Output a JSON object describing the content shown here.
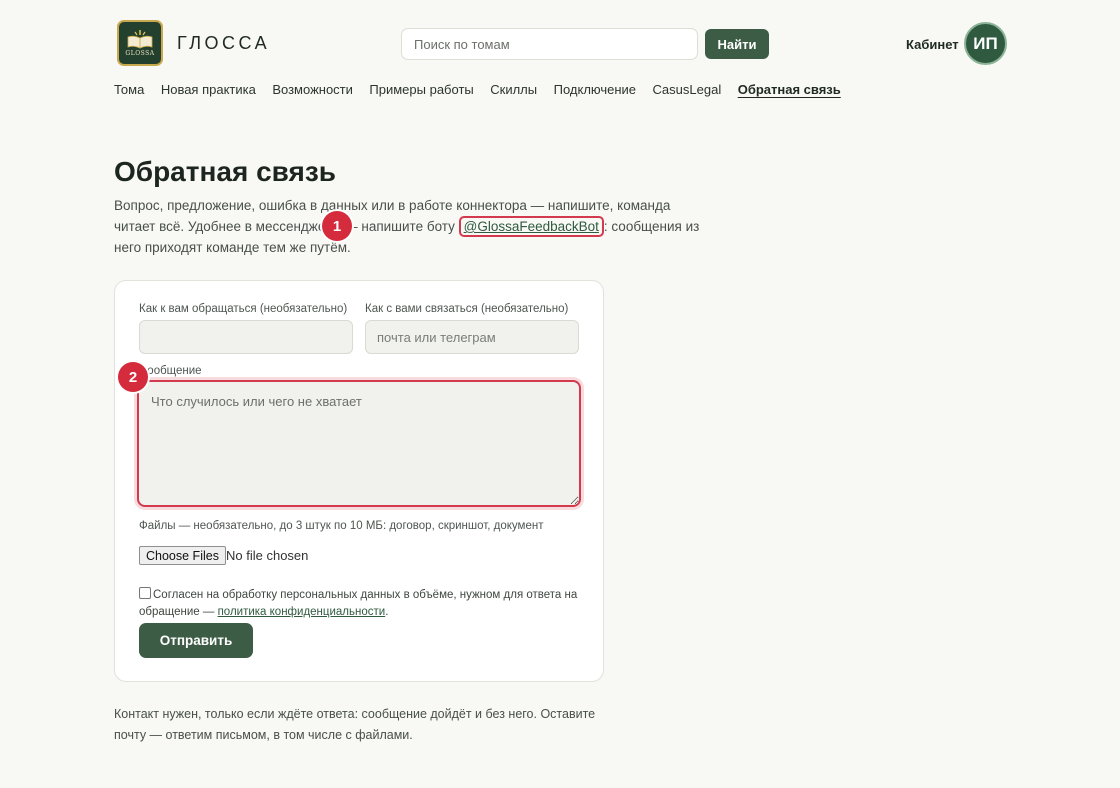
{
  "header": {
    "brand": "ГЛОССА",
    "logo_text": "GLOSSA",
    "search_placeholder": "Поиск по томам",
    "search_button": "Найти",
    "cabinet": "Кабинет",
    "avatar_initials": "ИП"
  },
  "nav": {
    "items": [
      "Тома",
      "Новая практика",
      "Возможности",
      "Примеры работы",
      "Скиллы",
      "Подключение",
      "CasusLegal",
      "Обратная связь"
    ],
    "active": "Обратная связь"
  },
  "page": {
    "title": "Обратная связь",
    "intro_part1": "Вопрос, предложение, ошибка в данных или в работе коннектора — напишите, команда читает всё. Удобнее в мессенджере — напишите боту ",
    "bot_handle": "@GlossaFeedbackBot",
    "intro_part2": ": сообщения из него приходят команде тем же путём."
  },
  "markers": [
    "1",
    "2"
  ],
  "form": {
    "name_label": "Как к вам обращаться (необязательно)",
    "name_value": "",
    "contact_label": "Как с вами связаться (необязательно)",
    "contact_placeholder": "почта или телеграм",
    "message_label": "Сообщение",
    "message_placeholder": "Что случилось или чего не хватает",
    "files_note": "Файлы — необязательно, до 3 штук по 10 МБ: договор, скриншот, документ",
    "file_button": "Choose Files",
    "file_status": "No file chosen",
    "consent_text": "Согласен на обработку персональных данных в объёме, нужном для ответа на обращение — ",
    "consent_link": "политика конфиденциальности",
    "consent_end": ".",
    "submit": "Отправить"
  },
  "footer_note": "Контакт нужен, только если ждёте ответа: сообщение дойдёт и без него. Оставите почту — ответим письмом, в том числе с файлами.",
  "colors": {
    "accent": "#3d5c45",
    "highlight": "#d33a4e",
    "background": "#f8f8f4"
  }
}
